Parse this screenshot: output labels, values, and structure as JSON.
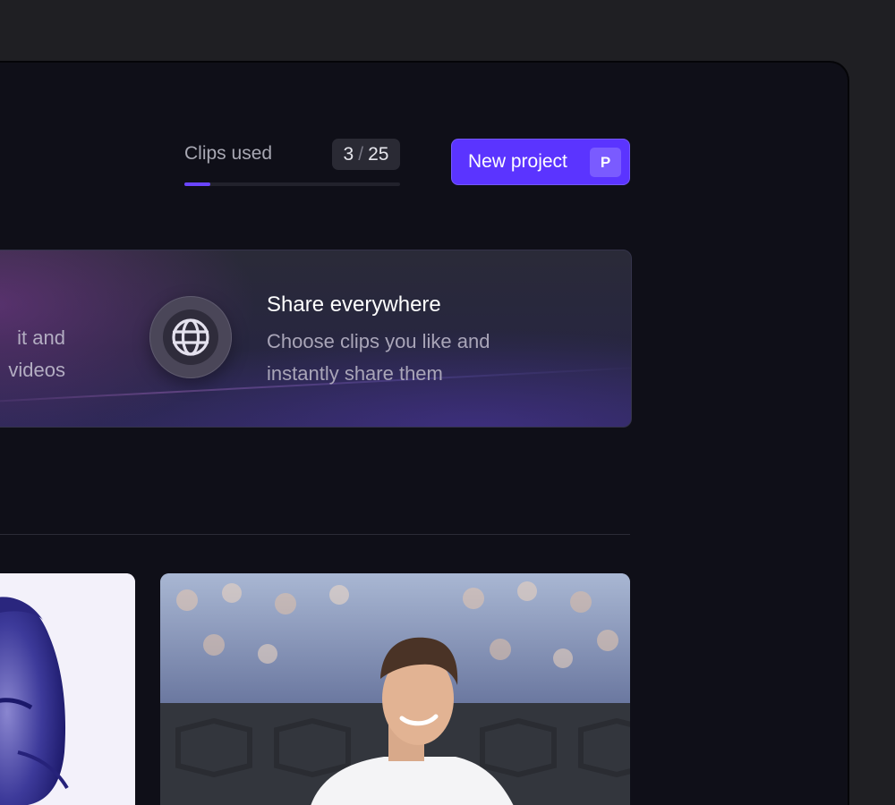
{
  "header": {
    "clips_label": "Clips used",
    "clips_used": "3",
    "clips_sep": "/",
    "clips_total": "25",
    "clips_progress_fraction": 0.12,
    "new_project_label": "New project",
    "new_project_shortcut": "P"
  },
  "feature": {
    "left_partial_line1": "it and",
    "left_partial_line2": "videos",
    "icon": "globe-icon",
    "title": "Share everywhere",
    "description_line1": "Choose clips you like and",
    "description_line2": "instantly share them"
  },
  "thumbnails": [
    {
      "name": "portrait-thumbnail",
      "style": "purple-duotone portrait"
    },
    {
      "name": "tennis-player-thumbnail",
      "style": "photo"
    }
  ],
  "colors": {
    "accent": "#5b34ff",
    "progress": "#6a45ff",
    "window_bg": "#0f0f18",
    "outer_bg": "#1f1f23"
  }
}
